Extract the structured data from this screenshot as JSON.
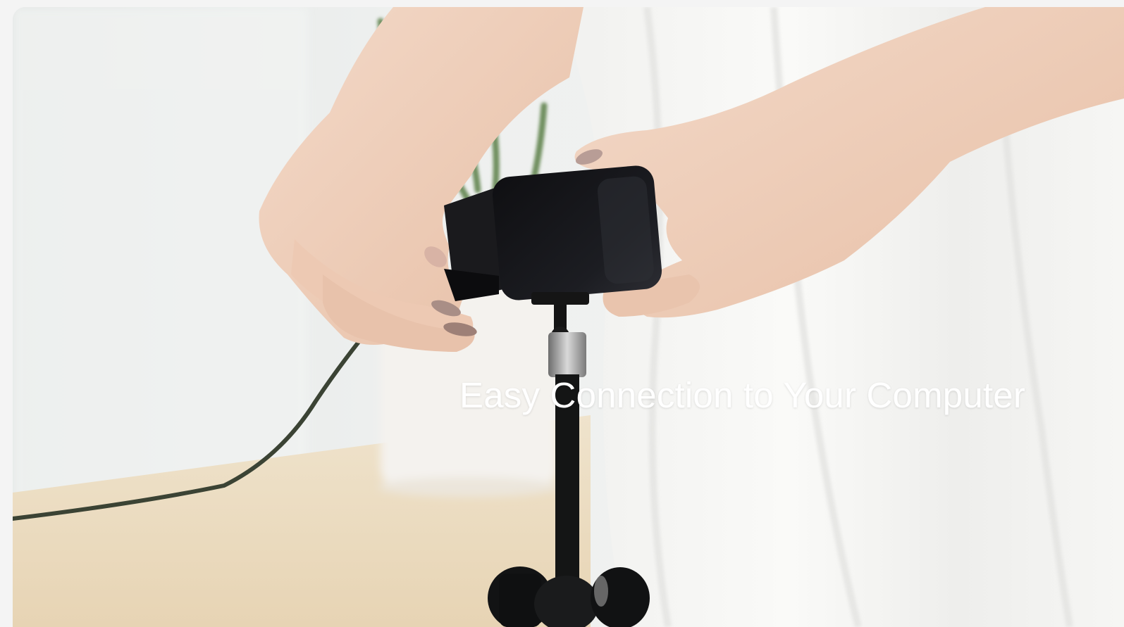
{
  "hero": {
    "caption": "Easy Connection to Your Computer",
    "image_subject": "hands-mounting-webcam-on-tripod"
  },
  "colors": {
    "caption_text": "#ffffff",
    "background": "#f4f4f4"
  }
}
